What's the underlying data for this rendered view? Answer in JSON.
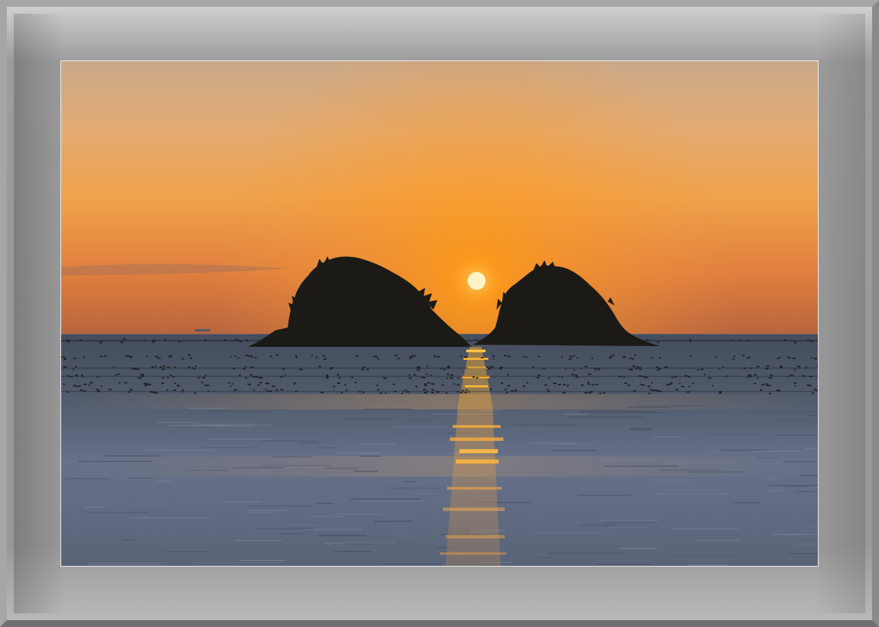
{
  "scene": {
    "subject": "sunset-over-two-islands",
    "colors": {
      "sky_top": "#c9a98a",
      "sky_mid": "#f0a24a",
      "sky_glow": "#ff9d12",
      "sky_horizon": "#c4673a",
      "sun": "#fff3c8",
      "sea_far": "#4b5566",
      "sea_near": "#6b7688",
      "reflection": "#ffb02e",
      "island": "#1c1a17",
      "frame": "#999999"
    }
  }
}
